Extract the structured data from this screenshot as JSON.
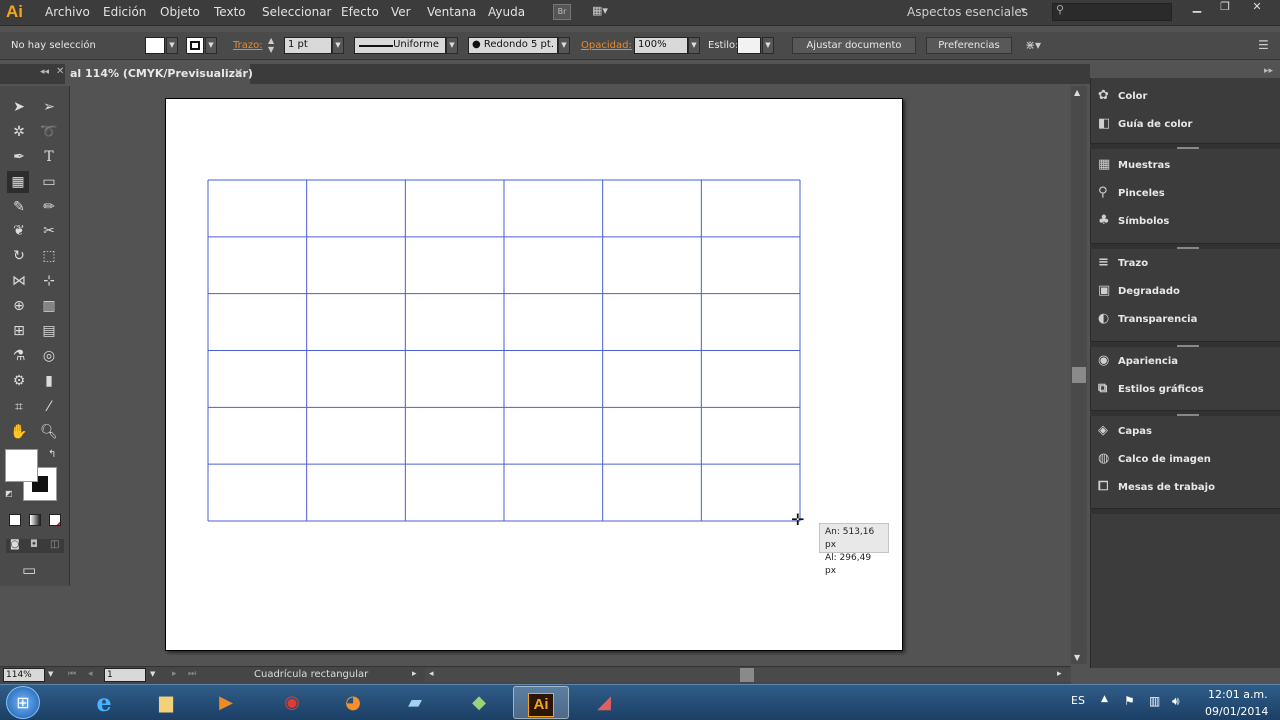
{
  "app": {
    "logo": "Ai"
  },
  "menu": [
    "Archivo",
    "Edición",
    "Objeto",
    "Texto",
    "Seleccionar",
    "Efecto",
    "Ver",
    "Ventana",
    "Ayuda"
  ],
  "workspace": {
    "label": "Aspectos esenciales",
    "search_placeholder": ""
  },
  "controlbar": {
    "selection": "No hay selección",
    "stroke_label": "Trazo:",
    "stroke_weight": "1 pt",
    "stroke_profile": "Uniforme",
    "brush": "Redondo 5 pt.",
    "opacity_label": "Opacidad:",
    "opacity": "100%",
    "style_label": "Estilo:",
    "adjust_doc": "Ajustar documento",
    "preferences": "Preferencias"
  },
  "document_tab": {
    "title": "al 114% (CMYK/Previsualizar)"
  },
  "grid": {
    "rows": 6,
    "columns": 6,
    "line_color": "#4a5fd0"
  },
  "tooltip": {
    "width": "An: 513,16 px",
    "height": "Al: 296,49 px"
  },
  "statusbar": {
    "zoom": "114%",
    "artboard": "1",
    "tool_name": "Cuadrícula rectangular"
  },
  "panels": [
    {
      "label": "Color",
      "icon": "color-icon"
    },
    {
      "label": "Guía de color",
      "icon": "color-guide-icon"
    },
    {
      "label": "Muestras",
      "icon": "swatches-icon"
    },
    {
      "label": "Pinceles",
      "icon": "brushes-icon"
    },
    {
      "label": "Símbolos",
      "icon": "symbols-icon"
    },
    {
      "label": "Trazo",
      "icon": "stroke-icon"
    },
    {
      "label": "Degradado",
      "icon": "gradient-icon"
    },
    {
      "label": "Transparencia",
      "icon": "transparency-icon"
    },
    {
      "label": "Apariencia",
      "icon": "appearance-icon"
    },
    {
      "label": "Estilos gráficos",
      "icon": "graphic-styles-icon"
    },
    {
      "label": "Capas",
      "icon": "layers-icon"
    },
    {
      "label": "Calco de imagen",
      "icon": "image-trace-icon"
    },
    {
      "label": "Mesas de trabajo",
      "icon": "artboards-icon"
    }
  ],
  "taskbar": {
    "language": "ES",
    "time": "12:01 a.m.",
    "date": "09/01/2014"
  }
}
